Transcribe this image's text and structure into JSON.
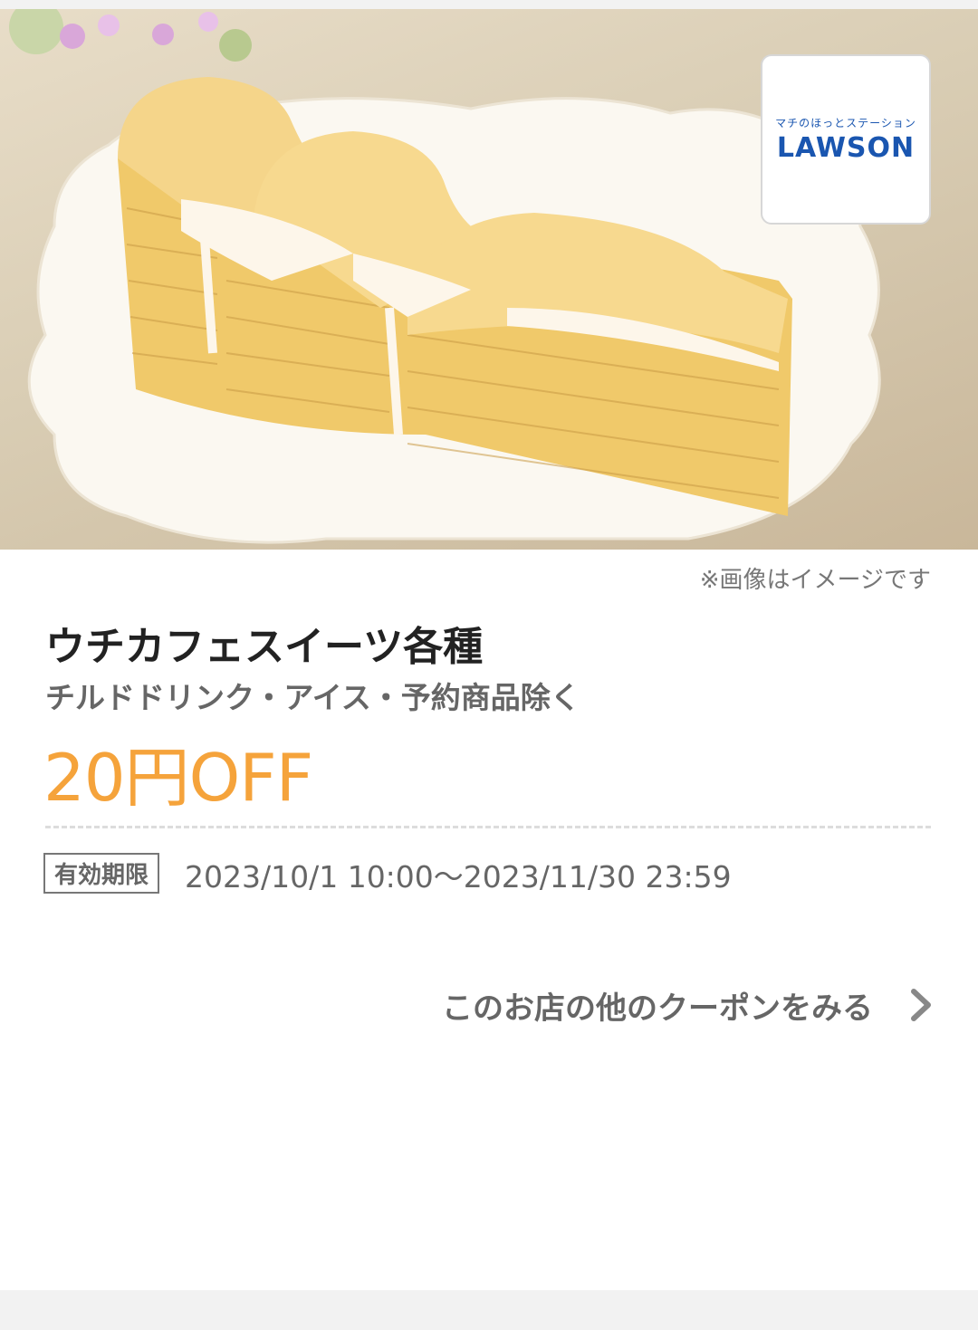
{
  "hero": {
    "image_description_icon": "cake-photo",
    "store_logo": {
      "tagline": "マチのほっとステーション",
      "name": "LAWSON",
      "color": "#1a56b0"
    }
  },
  "coupon": {
    "image_note": "※画像はイメージです",
    "title": "ウチカフェスイーツ各種",
    "subtitle": "チルドドリンク・アイス・予約商品除く",
    "discount": "20円OFF",
    "discount_color": "#f5a33b",
    "validity_label": "有効期限",
    "validity_period": "2023/10/1 10:00〜2023/11/30 23:59"
  },
  "footer": {
    "more_coupons_label": "このお店の他のクーポンをみる",
    "more_icon": "chevron-right-icon"
  }
}
